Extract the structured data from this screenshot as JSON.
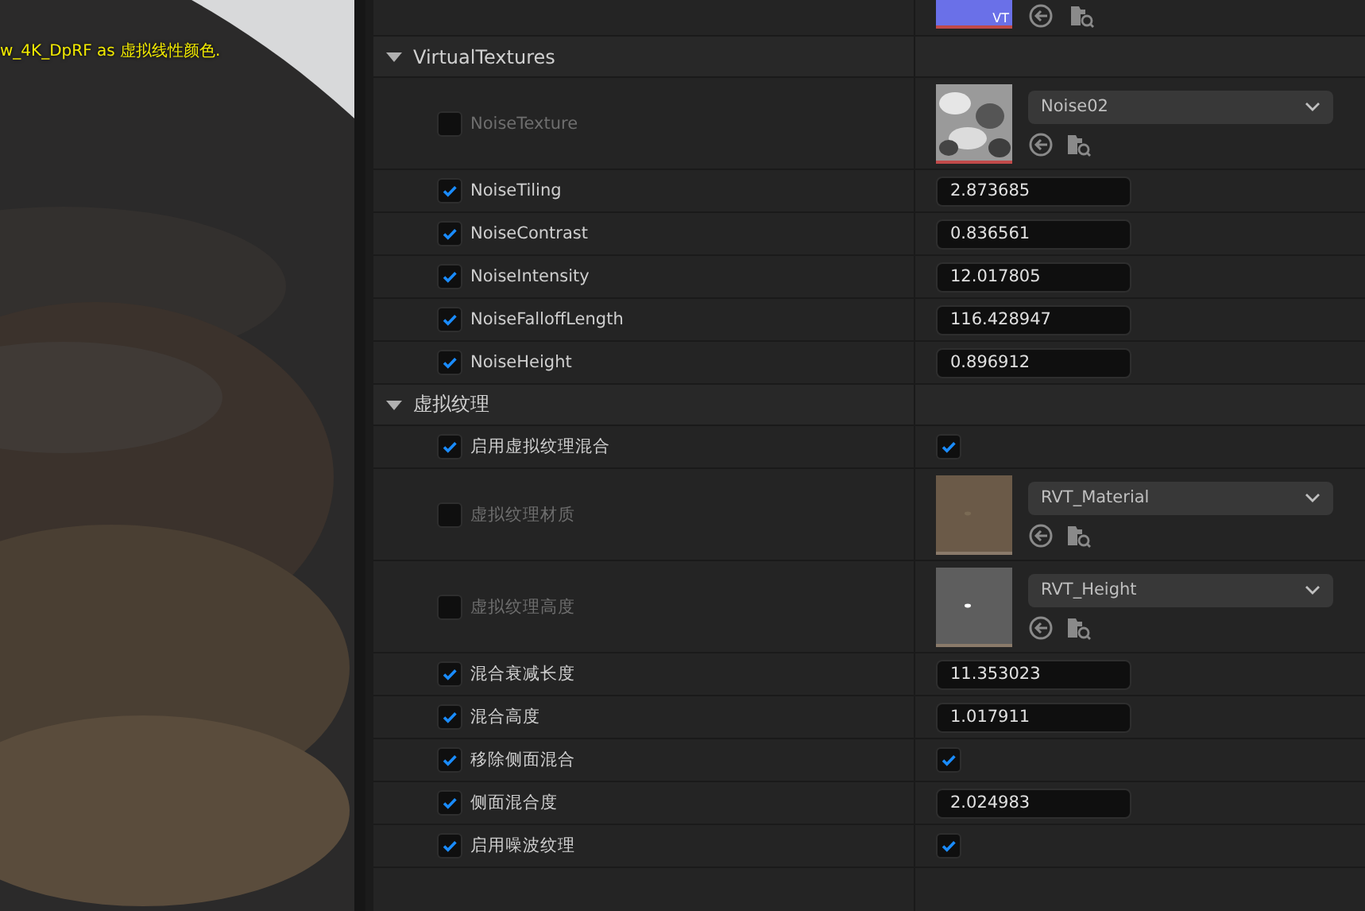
{
  "viewport": {
    "message": "w_4K_DpRF as 虚拟线性颜色."
  },
  "top_row": {
    "badge": "VT"
  },
  "sections": [
    {
      "title": "VirtualTextures",
      "expanded": true,
      "rows": [
        {
          "kind": "texture",
          "label": "NoiseTexture",
          "enabled": false,
          "asset": "Noise02"
        },
        {
          "kind": "number",
          "label": "NoiseTiling",
          "enabled": true,
          "value": "2.873685"
        },
        {
          "kind": "number",
          "label": "NoiseContrast",
          "enabled": true,
          "value": "0.836561"
        },
        {
          "kind": "number",
          "label": "NoiseIntensity",
          "enabled": true,
          "value": "12.017805"
        },
        {
          "kind": "number",
          "label": "NoiseFalloffLength",
          "enabled": true,
          "value": "116.428947"
        },
        {
          "kind": "number",
          "label": "NoiseHeight",
          "enabled": true,
          "value": "0.896912"
        }
      ]
    },
    {
      "title": "虚拟纹理",
      "expanded": true,
      "rows": [
        {
          "kind": "bool",
          "label": "启用虚拟纹理混合",
          "enabled": true,
          "checked": true
        },
        {
          "kind": "texture",
          "label": "虚拟纹理材质",
          "enabled": false,
          "asset": "RVT_Material"
        },
        {
          "kind": "texture",
          "label": "虚拟纹理高度",
          "enabled": false,
          "asset": "RVT_Height"
        },
        {
          "kind": "number",
          "label": "混合衰减长度",
          "enabled": true,
          "value": "11.353023"
        },
        {
          "kind": "number",
          "label": "混合高度",
          "enabled": true,
          "value": "1.017911"
        },
        {
          "kind": "bool",
          "label": "移除侧面混合",
          "enabled": true,
          "checked": true
        },
        {
          "kind": "number",
          "label": "侧面混合度",
          "enabled": true,
          "value": "2.024983"
        },
        {
          "kind": "bool",
          "label": "启用噪波纹理",
          "enabled": true,
          "checked": true
        }
      ]
    }
  ]
}
